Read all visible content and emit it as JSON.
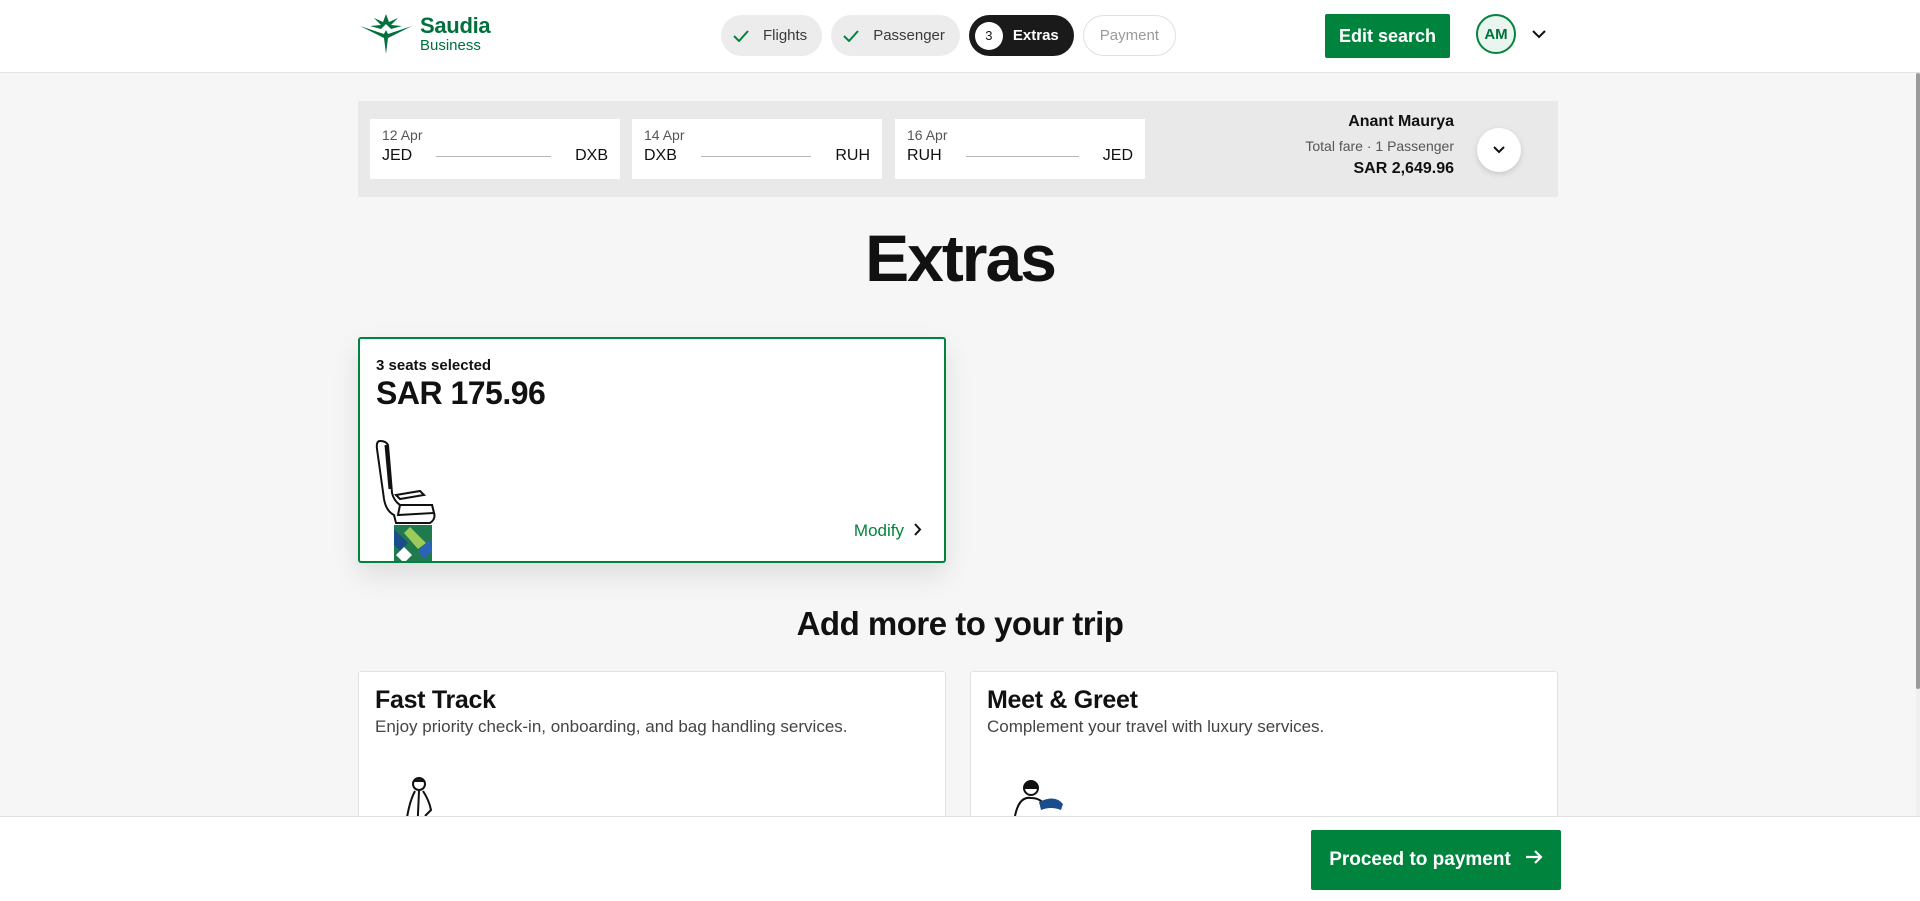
{
  "brand": {
    "line1": "Saudia",
    "line2": "Business"
  },
  "steps": [
    {
      "label": "Flights",
      "state": "done"
    },
    {
      "label": "Passenger",
      "state": "done"
    },
    {
      "label": "Extras",
      "state": "active",
      "number": "3"
    },
    {
      "label": "Payment",
      "state": "todo"
    }
  ],
  "header": {
    "edit_search": "Edit search",
    "avatar_initials": "AM"
  },
  "itinerary": {
    "segments": [
      {
        "date": "12 Apr",
        "from": "JED",
        "to": "DXB"
      },
      {
        "date": "14 Apr",
        "from": "DXB",
        "to": "RUH"
      },
      {
        "date": "16 Apr",
        "from": "RUH",
        "to": "JED"
      }
    ],
    "passenger_name": "Anant Maurya",
    "fare_label": "Total fare · 1 Passenger",
    "total": "SAR 2,649.96"
  },
  "page_title": "Extras",
  "seats": {
    "count_label": "3 seats selected",
    "price": "SAR 175.96",
    "modify_label": "Modify"
  },
  "add_more": {
    "title": "Add more to your trip",
    "services": [
      {
        "title": "Fast Track",
        "description": "Enjoy priority check-in, onboarding, and bag handling services."
      },
      {
        "title": "Meet & Greet",
        "description": "Complement your travel with luxury services."
      }
    ]
  },
  "footer": {
    "proceed_label": "Proceed to payment"
  },
  "colors": {
    "brand_green": "#00843d",
    "dark": "#1a1a1a"
  }
}
